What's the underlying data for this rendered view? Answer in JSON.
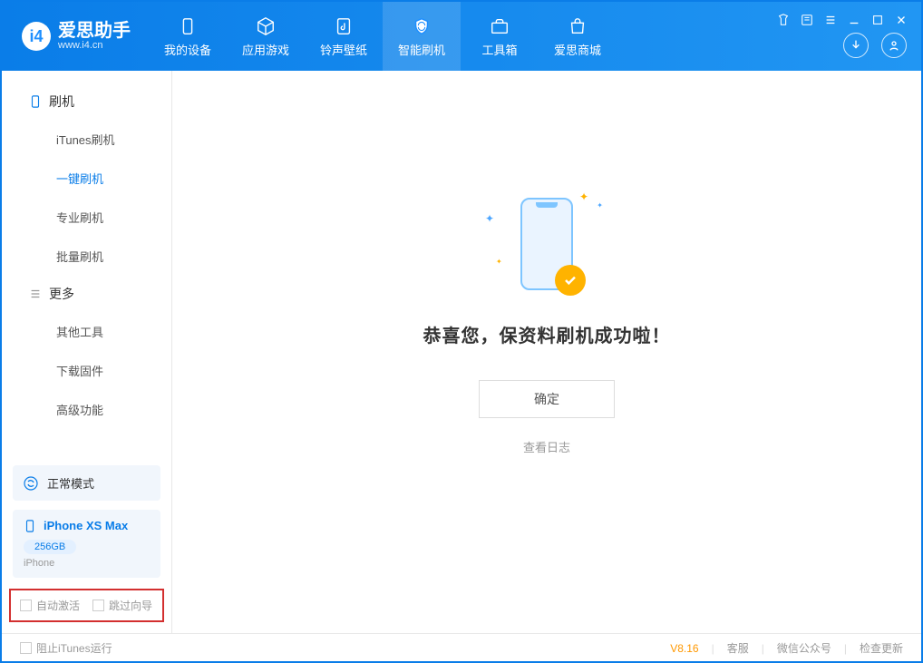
{
  "app": {
    "title": "爱思助手",
    "subtitle": "www.i4.cn"
  },
  "nav": {
    "items": [
      "我的设备",
      "应用游戏",
      "铃声壁纸",
      "智能刷机",
      "工具箱",
      "爱思商城"
    ]
  },
  "sidebar": {
    "section1": {
      "title": "刷机",
      "items": [
        "iTunes刷机",
        "一键刷机",
        "专业刷机",
        "批量刷机"
      ]
    },
    "section2": {
      "title": "更多",
      "items": [
        "其他工具",
        "下载固件",
        "高级功能"
      ]
    },
    "status": "正常模式",
    "device": {
      "name": "iPhone XS Max",
      "capacity": "256GB",
      "type": "iPhone"
    },
    "checkboxes": {
      "auto_activate": "自动激活",
      "skip_guide": "跳过向导"
    }
  },
  "main": {
    "success_text": "恭喜您，保资料刷机成功啦！",
    "ok_button": "确定",
    "view_log": "查看日志"
  },
  "footer": {
    "block_itunes": "阻止iTunes运行",
    "version": "V8.16",
    "links": [
      "客服",
      "微信公众号",
      "检查更新"
    ]
  }
}
